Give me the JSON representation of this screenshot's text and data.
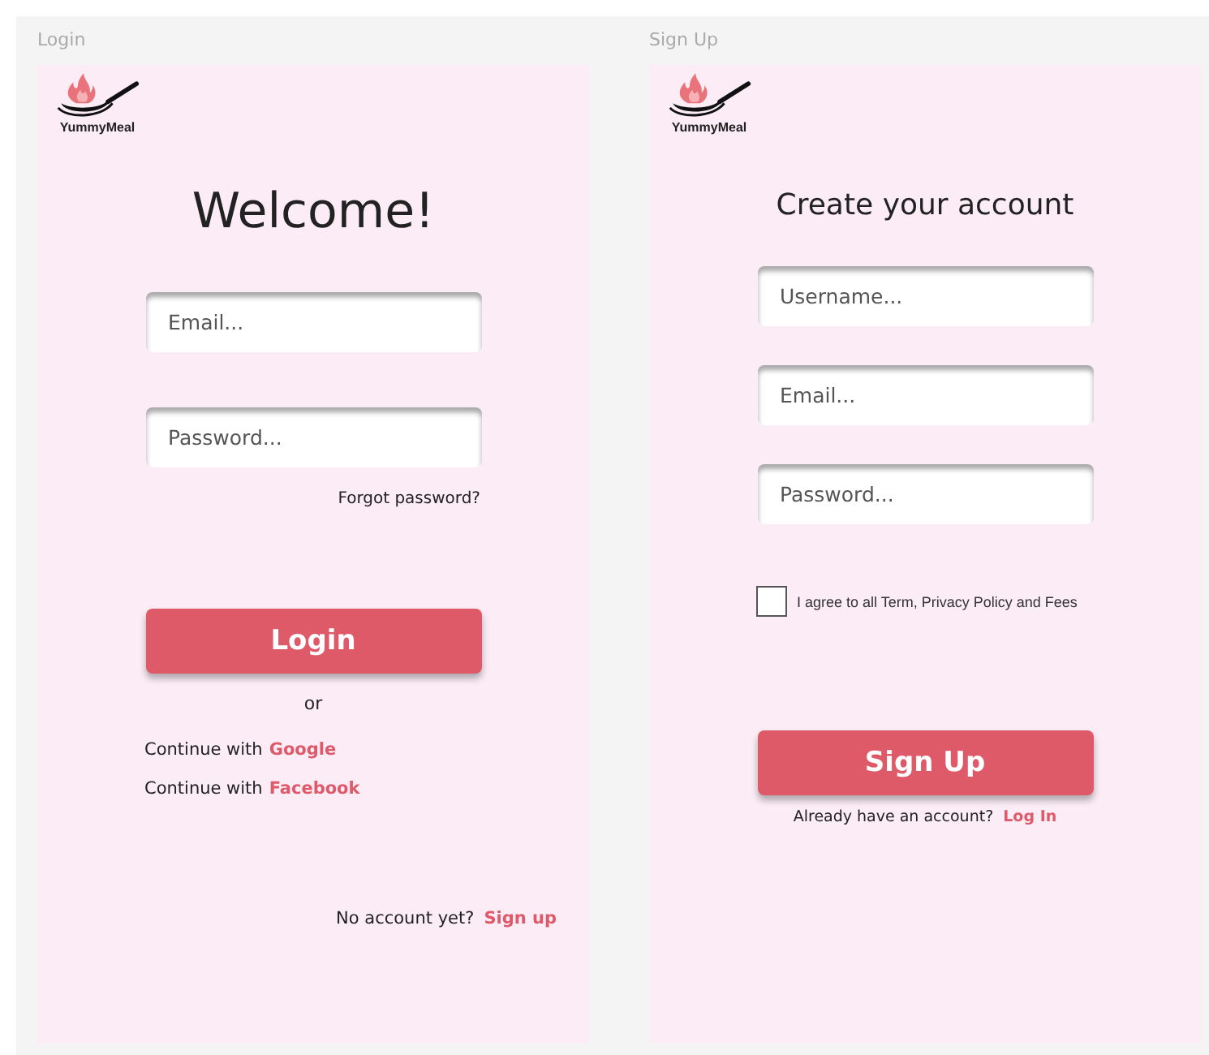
{
  "login": {
    "frame_label": "Login",
    "brand": "YummyMeal",
    "title": "Welcome!",
    "fields": [
      {
        "placeholder": "Email..."
      },
      {
        "placeholder": "Password..."
      }
    ],
    "forgot_link": "Forgot password?",
    "button": "Login",
    "separator": "or",
    "social": [
      {
        "prefix": "Continue with",
        "provider": "Google"
      },
      {
        "prefix": "Continue with",
        "provider": "Facebook"
      }
    ],
    "footer": {
      "text": "No account yet?",
      "link": "Sign up"
    }
  },
  "signup": {
    "frame_label": "Sign Up",
    "brand": "YummyMeal",
    "title": "Create your account",
    "fields": [
      {
        "placeholder": "Username..."
      },
      {
        "placeholder": "Email..."
      },
      {
        "placeholder": "Password..."
      }
    ],
    "agree": {
      "label": "I agree to all Term, Privacy Policy and Fees",
      "checked": false
    },
    "button": "Sign Up",
    "footer": {
      "text": "Already have an account?",
      "link": "Log In"
    }
  }
}
